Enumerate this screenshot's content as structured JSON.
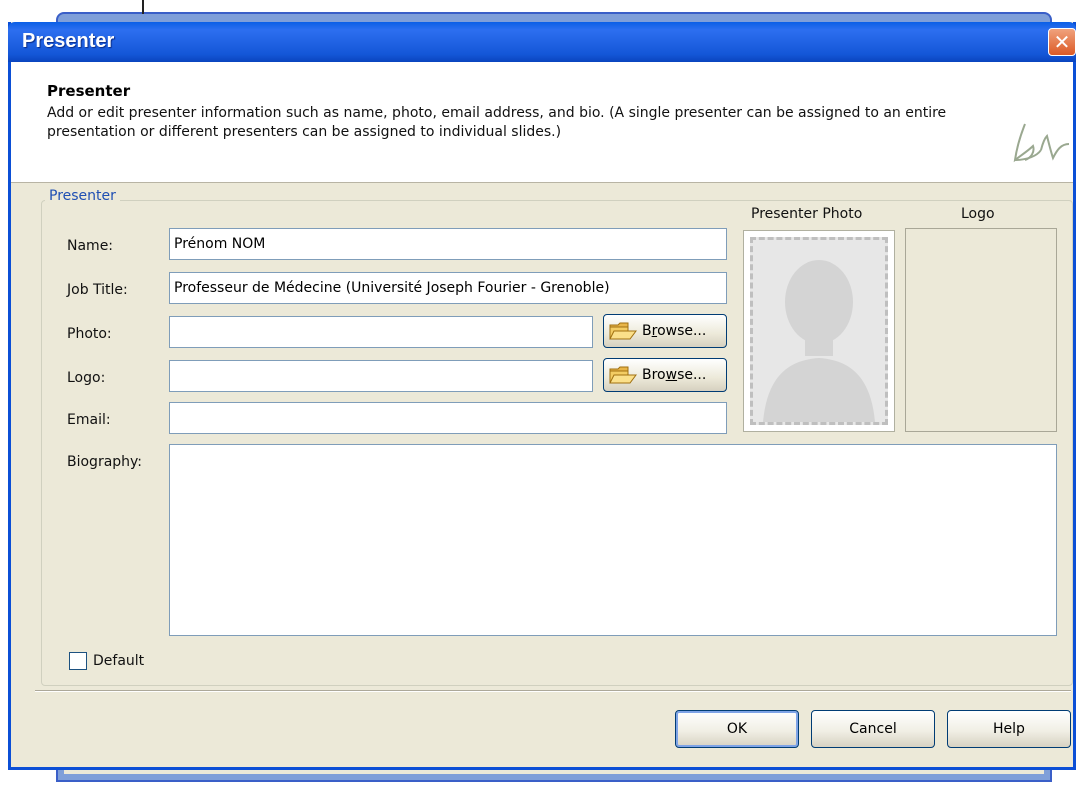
{
  "dialog": {
    "title": "Presenter",
    "close_glyph": "✕"
  },
  "header": {
    "title": "Presenter",
    "description": "Add or edit presenter information such as name, photo, email address, and bio. (A single presenter can be assigned to an entire presentation or different presenters can be assigned to individual slides.)",
    "logo_icon": "brand-logo-icon"
  },
  "group": {
    "legend": "Presenter",
    "name_label": "Name:",
    "name_value": "Prénom NOM",
    "job_label": "Job Title:",
    "job_value": "Professeur de Médecine (Université Joseph Fourier - Grenoble)",
    "photo_label": "Photo:",
    "photo_value": "",
    "logo_label": "Logo:",
    "logo_value": "",
    "email_label": "Email:",
    "email_value": "",
    "bio_label": "Biography:",
    "bio_value": "",
    "browse_pre": "B",
    "browse_u": "r",
    "browse_post": "owse...",
    "browse2_pre": "Bro",
    "browse2_u": "w",
    "browse2_post": "se...",
    "presenter_photo_label": "Presenter Photo",
    "logo_preview_label": "Logo",
    "default_label": "Default"
  },
  "buttons": {
    "ok": "OK",
    "cancel": "Cancel",
    "help": "Help"
  },
  "colors": {
    "titlebar": "#0a5fe6",
    "dialog_bg": "#ece9d8",
    "legend_text": "#1f4fb3"
  }
}
